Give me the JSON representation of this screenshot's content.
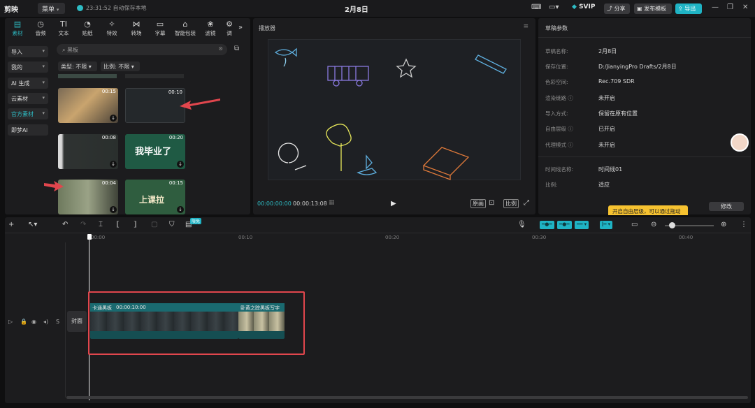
{
  "titlebar": {
    "app_name": "剪映",
    "menu_label": "菜单",
    "save_status": "23:31:52 自动保存本地",
    "doc_title": "2月8日",
    "svip_label": "SVIP",
    "share_label": "分享",
    "publish_template_label": "发布模板",
    "export_label": "导出"
  },
  "media_tabs": [
    {
      "label": "素材",
      "icon": "media-icon"
    },
    {
      "label": "音频",
      "icon": "audio-icon"
    },
    {
      "label": "文本",
      "icon": "text-icon"
    },
    {
      "label": "贴纸",
      "icon": "sticker-icon"
    },
    {
      "label": "特效",
      "icon": "effects-icon"
    },
    {
      "label": "转场",
      "icon": "transition-icon"
    },
    {
      "label": "字幕",
      "icon": "subtitle-icon"
    },
    {
      "label": "智能包装",
      "icon": "smart-pack-icon"
    },
    {
      "label": "滤镜",
      "icon": "filter-icon"
    },
    {
      "label": "调",
      "icon": "adjust-icon"
    }
  ],
  "categories": [
    {
      "label": "导入"
    },
    {
      "label": "我的"
    },
    {
      "label": "AI 生成"
    },
    {
      "label": "云素材"
    },
    {
      "label": "官方素材"
    },
    {
      "label": "即梦AI"
    }
  ],
  "search": {
    "value": "黑板"
  },
  "filters": {
    "type_label": "类型: 不限",
    "ratio_label": "比例: 不限"
  },
  "thumbnails": [
    {
      "duration": "00:15"
    },
    {
      "duration": "00:10"
    },
    {
      "duration": "00:08"
    },
    {
      "duration": "00:20"
    },
    {
      "duration": "00:04"
    },
    {
      "duration": "00:15"
    }
  ],
  "player": {
    "title": "播放器",
    "current_time": "00:00:00:00",
    "total_time": "00:00:13:08",
    "original_label": "原画",
    "ratio_label": "比例"
  },
  "props": {
    "title": "草稿参数",
    "rows": [
      {
        "label": "草稿名称:",
        "value": "2月8日"
      },
      {
        "label": "保存位置:",
        "value": "D:/JianyingPro Drafts/2月8日"
      },
      {
        "label": "色彩空间:",
        "value": "Rec.709 SDR"
      },
      {
        "label": "渲染链路",
        "value": "未开启"
      },
      {
        "label": "导入方式:",
        "value": "保留在原有位置"
      },
      {
        "label": "自由层级",
        "value": "已开启"
      },
      {
        "label": "代理模式",
        "value": "未开启"
      },
      {
        "label": "时间线名称:",
        "value": "时间线01"
      },
      {
        "label": "比例:",
        "value": "适应"
      }
    ],
    "banner_text": "开启自由层级，可以通过拖动",
    "modify_label": "修改"
  },
  "timeline": {
    "free_badge": "限免",
    "ruler": [
      "00:00",
      "00:10",
      "00:20",
      "00:30",
      "00:40"
    ],
    "cover_label": "封面",
    "clip1_title": "卡通黑板",
    "clip1_time": "00:00:10:00",
    "clip2_title": "卧黄之踪黑板写字"
  },
  "colors": {
    "accent": "#1fb3c4",
    "highlight_box": "#e1464d",
    "banner": "#f6c230"
  }
}
